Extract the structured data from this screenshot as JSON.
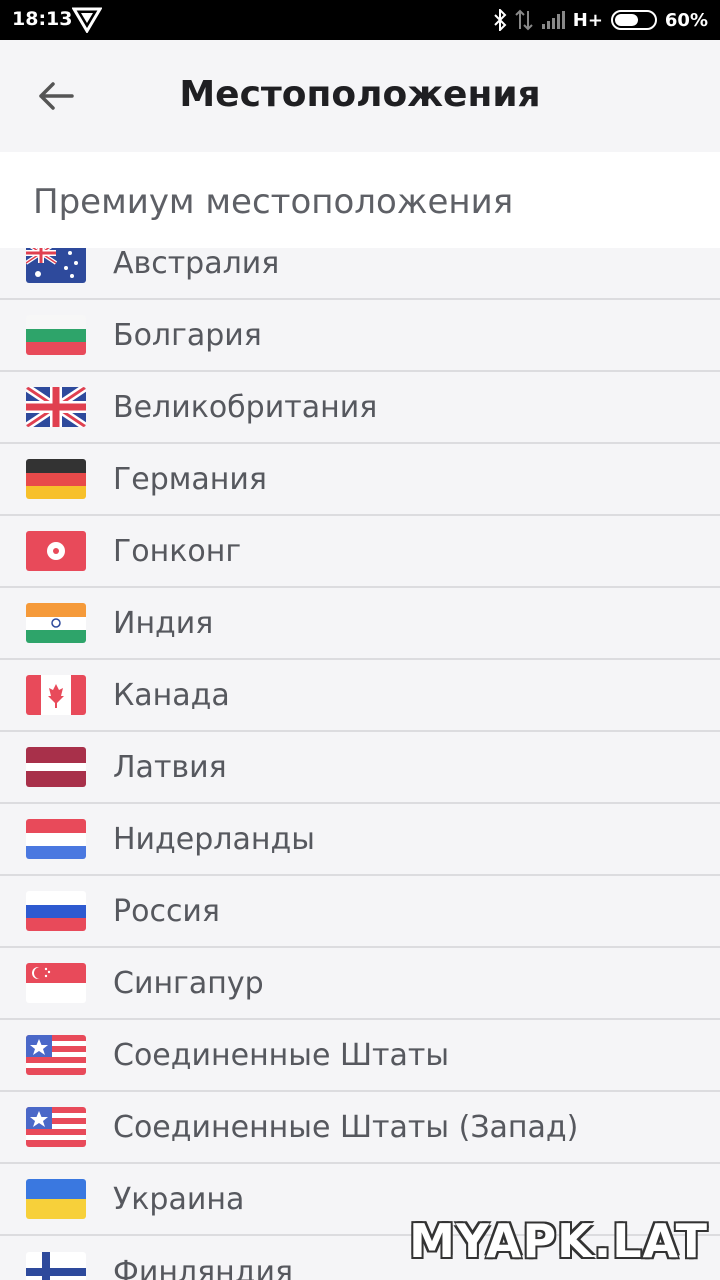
{
  "status_bar": {
    "time": "18:13",
    "network": "H+",
    "battery_percent": "60%",
    "battery_level": 0.6
  },
  "app_bar": {
    "title": "Местоположения",
    "back_icon": "arrow-left-icon"
  },
  "section": {
    "title": "Премиум местоположения"
  },
  "locations": [
    {
      "name": "Австралия",
      "flag": "flag-au"
    },
    {
      "name": "Болгария",
      "flag": "flag-bg"
    },
    {
      "name": "Великобритания",
      "flag": "flag-gb"
    },
    {
      "name": "Германия",
      "flag": "flag-de"
    },
    {
      "name": "Гонконг",
      "flag": "flag-hk"
    },
    {
      "name": "Индия",
      "flag": "flag-in"
    },
    {
      "name": "Канада",
      "flag": "flag-ca"
    },
    {
      "name": "Латвия",
      "flag": "flag-lv"
    },
    {
      "name": "Нидерланды",
      "flag": "flag-nl"
    },
    {
      "name": "Россия",
      "flag": "flag-ru"
    },
    {
      "name": "Сингапур",
      "flag": "flag-sg"
    },
    {
      "name": "Соединенные Штаты",
      "flag": "flag-us"
    },
    {
      "name": "Соединенные Штаты (Запад)",
      "flag": "flag-us"
    },
    {
      "name": "Украина",
      "flag": "flag-ua"
    },
    {
      "name": "Финляндия",
      "flag": "flag-fi"
    }
  ],
  "watermark": "MYAPK.LAT",
  "colors": {
    "background": "#f5f5f7",
    "text": "#56585e",
    "title": "#1f1f22"
  }
}
